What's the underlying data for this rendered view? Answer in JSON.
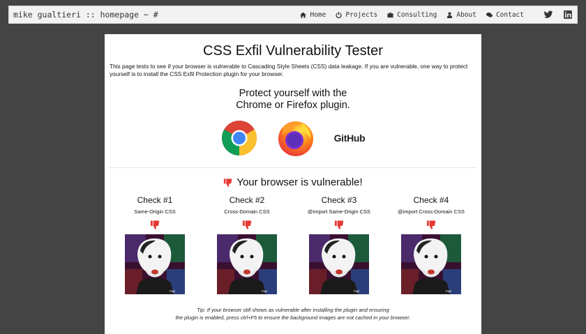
{
  "navbar": {
    "brand": "mike gualtieri :: homepage ~ #",
    "items": [
      {
        "label": "Home",
        "icon": "home-icon"
      },
      {
        "label": "Projects",
        "icon": "power-icon"
      },
      {
        "label": "Consulting",
        "icon": "briefcase-icon"
      },
      {
        "label": "About",
        "icon": "user-icon"
      },
      {
        "label": "Contact",
        "icon": "comments-icon"
      }
    ],
    "social": [
      "twitter-icon",
      "linkedin-icon"
    ]
  },
  "main": {
    "title": "CSS Exfil Vulnerability Tester",
    "intro": "This page tests to see if your browser is vulnerable to Cascading Style Sheets (CSS) data leakage. If you are vulnerable, one way to protect yourself is to install the CSS Exfil Protection plugin for your browser.",
    "protect_line1": "Protect yourself with the",
    "protect_line2": "Chrome or Firefox plugin.",
    "github_label": "GitHub",
    "status": "Your browser is vulnerable!",
    "checks": [
      {
        "title": "Check #1",
        "subtitle": "Same-Origin CSS"
      },
      {
        "title": "Check #2",
        "subtitle": "Cross-Domain CSS"
      },
      {
        "title": "Check #3",
        "subtitle": "@import Same-Origin CSS"
      },
      {
        "title": "Check #4",
        "subtitle": "@import Cross-Domain CSS"
      }
    ],
    "tip_line1": "Tip: If your browser still shows as vulnerable after installing the plugin and ensuring",
    "tip_line2": "the plugin is enabled, press ctrl+F5 to ensure the background images are not cached in your browser."
  },
  "colors": {
    "background": "#444444",
    "navbar": "#f2f2f2",
    "vulnerable_red": "#e53935"
  }
}
